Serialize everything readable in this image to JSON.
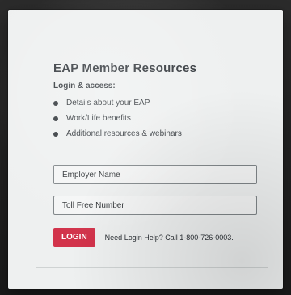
{
  "card": {
    "title": "EAP Member Resources",
    "subtitle": "Login & access:",
    "bullets": [
      "Details about your EAP",
      "Work/Life benefits",
      "Additional resources & webinars"
    ]
  },
  "form": {
    "employer_placeholder": "Employer Name",
    "toll_free_placeholder": "Toll Free Number",
    "login_label": "LOGIN",
    "help_text": "Need Login Help? Call 1-800-726-0003."
  },
  "colors": {
    "accent": "#d2334b",
    "card_bg": "#eef0f0",
    "text": "#2c3136"
  }
}
